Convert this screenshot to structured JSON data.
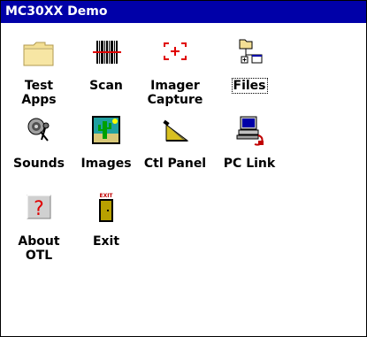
{
  "window": {
    "title": "MC30XX Demo",
    "title_bar_color": "#0000a8"
  },
  "apps": [
    {
      "label": "Test\nApps",
      "icon": "folder-icon",
      "selected": false
    },
    {
      "label": "Scan",
      "icon": "barcode-scan-icon",
      "selected": false
    },
    {
      "label": "Imager\nCapture",
      "icon": "imager-capture-icon",
      "selected": false
    },
    {
      "label": "Files",
      "icon": "file-explorer-icon",
      "selected": true
    },
    {
      "label": "Sounds",
      "icon": "speaker-microphone-icon",
      "selected": false
    },
    {
      "label": "Images",
      "icon": "cactus-picture-icon",
      "selected": false
    },
    {
      "label": "Ctl Panel",
      "icon": "pencil-panel-icon",
      "selected": false
    },
    {
      "label": "PC Link",
      "icon": "pc-link-icon",
      "selected": false
    },
    {
      "label": "About\nOTL",
      "icon": "question-mark-icon",
      "selected": false
    },
    {
      "label": "Exit",
      "icon": "exit-door-icon",
      "selected": false
    }
  ],
  "exit_sign_text": "EXIT",
  "about_symbol": "?"
}
